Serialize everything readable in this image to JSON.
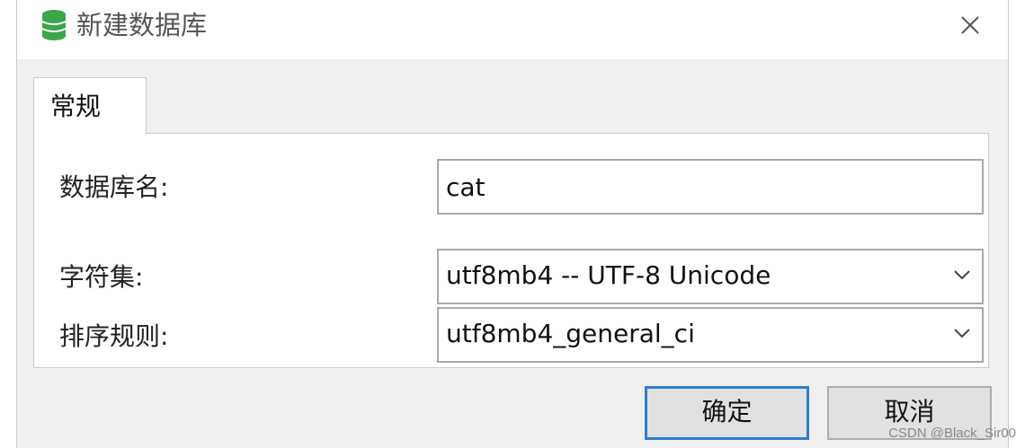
{
  "window": {
    "title": "新建数据库",
    "close_icon": "close-icon",
    "app_icon": "database-icon",
    "icon_color": "#3aa64a"
  },
  "tabs": [
    {
      "label": "常规",
      "active": true
    }
  ],
  "form": {
    "db_name_label": "数据库名:",
    "db_name_value": "cat",
    "charset_label": "字符集:",
    "charset_value": "utf8mb4 -- UTF-8 Unicode",
    "collation_label": "排序规则:",
    "collation_value": "utf8mb4_general_ci"
  },
  "buttons": {
    "ok": "确定",
    "cancel": "取消"
  },
  "watermark": "CSDN @Black_Sir00",
  "colors": {
    "accent_border": "#2a7ed3",
    "dialog_bg": "#f0f0f0"
  }
}
